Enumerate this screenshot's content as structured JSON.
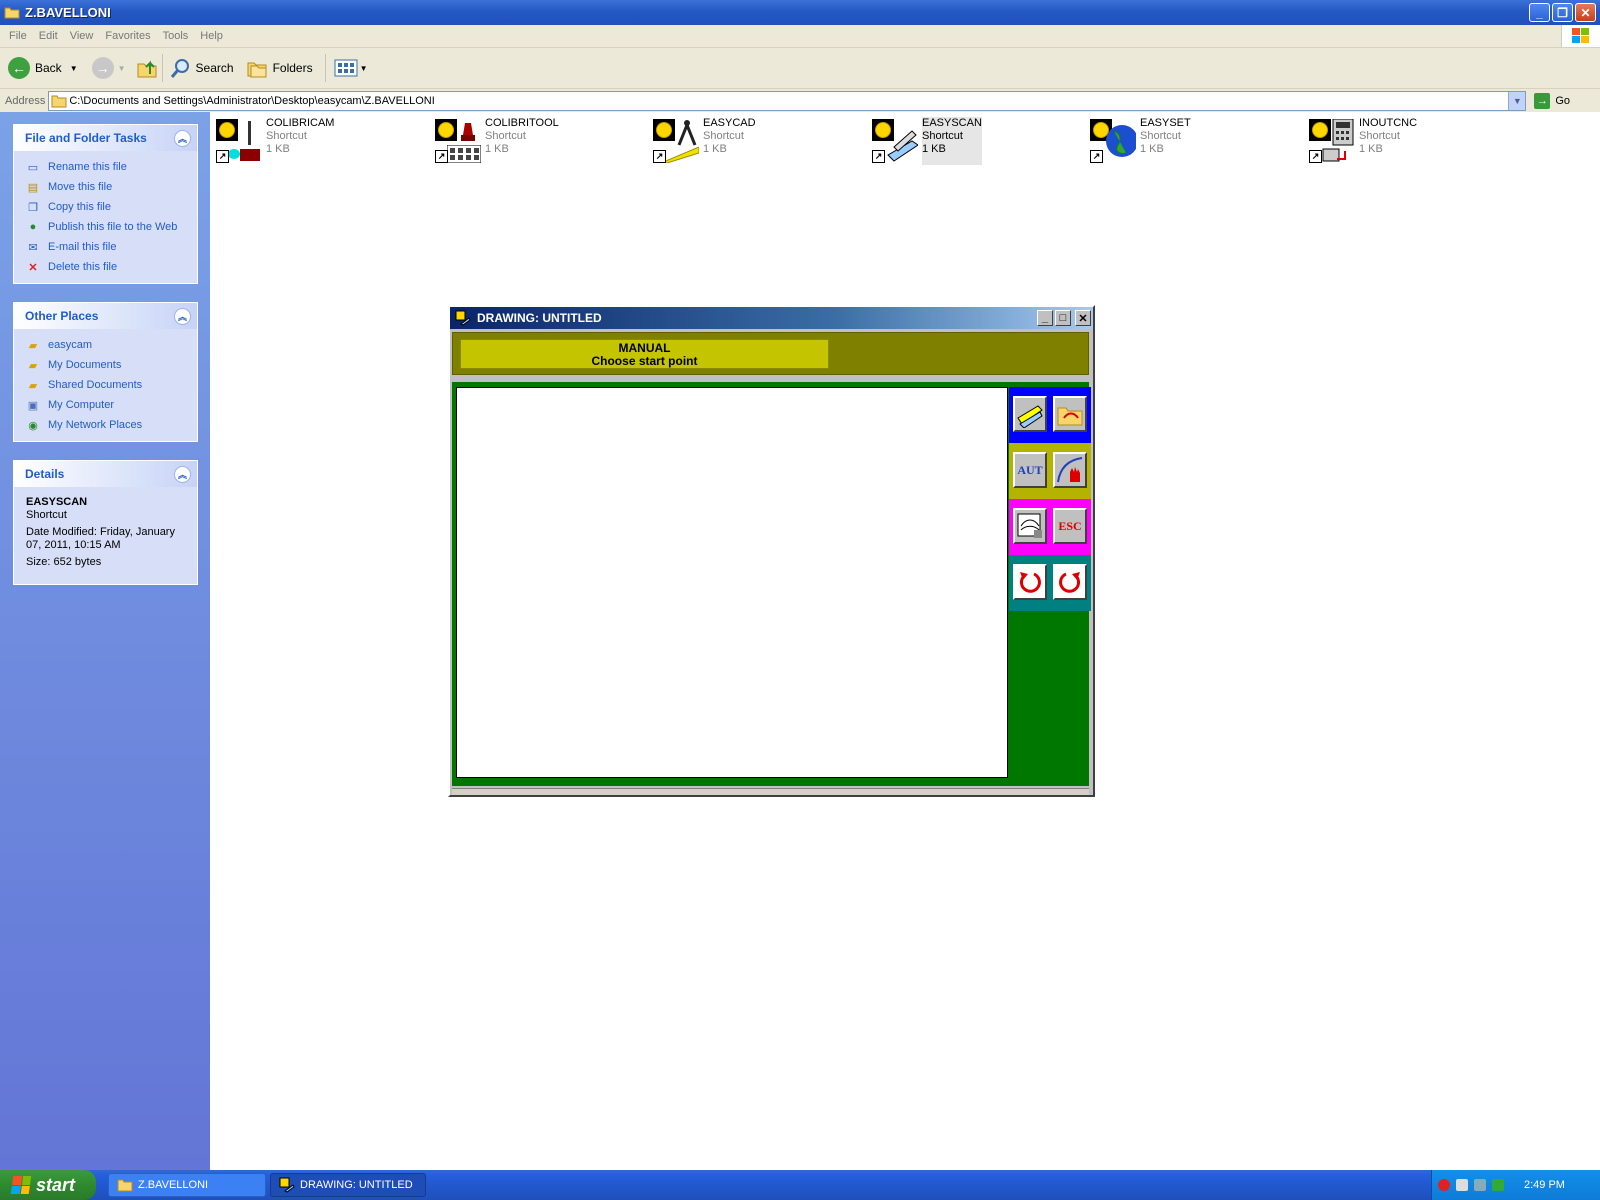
{
  "explorer": {
    "title": "Z.BAVELLONI",
    "menu": [
      "File",
      "Edit",
      "View",
      "Favorites",
      "Tools",
      "Help"
    ],
    "toolbar": {
      "back": "Back",
      "search": "Search",
      "folders": "Folders"
    },
    "address": {
      "label": "Address",
      "value": "C:\\Documents and Settings\\Administrator\\Desktop\\easycam\\Z.BAVELLONI",
      "go": "Go"
    }
  },
  "sidebar": {
    "tasks": {
      "title": "File and Folder Tasks",
      "items": [
        {
          "label": "Rename this file",
          "icon": "rename-icon"
        },
        {
          "label": "Move this file",
          "icon": "move-icon"
        },
        {
          "label": "Copy this file",
          "icon": "copy-icon"
        },
        {
          "label": "Publish this file to the Web",
          "icon": "globe-icon"
        },
        {
          "label": "E-mail this file",
          "icon": "mail-icon"
        },
        {
          "label": "Delete this file",
          "icon": "delete-icon"
        }
      ]
    },
    "places": {
      "title": "Other Places",
      "items": [
        {
          "label": "easycam",
          "icon": "folder-icon"
        },
        {
          "label": "My Documents",
          "icon": "documents-icon"
        },
        {
          "label": "Shared Documents",
          "icon": "folder-icon"
        },
        {
          "label": "My Computer",
          "icon": "computer-icon"
        },
        {
          "label": "My Network Places",
          "icon": "network-icon"
        }
      ]
    },
    "details": {
      "title": "Details",
      "name": "EASYSCAN",
      "type": "Shortcut",
      "modified": "Date Modified: Friday, January 07, 2011, 10:15 AM",
      "size": "Size: 652 bytes"
    }
  },
  "files": [
    {
      "name": "COLIBRICAM",
      "type": "Shortcut",
      "size": "1 KB"
    },
    {
      "name": "COLIBRITOOL",
      "type": "Shortcut",
      "size": "1 KB"
    },
    {
      "name": "EASYCAD",
      "type": "Shortcut",
      "size": "1 KB"
    },
    {
      "name": "EASYSCAN",
      "type": "Shortcut",
      "size": "1 KB",
      "selected": true
    },
    {
      "name": "EASYSET",
      "type": "Shortcut",
      "size": "1 KB"
    },
    {
      "name": "INOUTCNC",
      "type": "Shortcut",
      "size": "1 KB"
    }
  ],
  "drawing_window": {
    "title": "DRAWING: UNTITLED",
    "mode": "MANUAL",
    "prompt": "Choose start point",
    "tools": {
      "aut": "AUT",
      "esc": "ESC"
    },
    "colors": {
      "frame": "#007700",
      "status": "#808000",
      "status_box": "#c4c400",
      "group1": "#0000ff",
      "group2": "#b4b400",
      "group3": "#ff00ff",
      "group4": "#008080"
    }
  },
  "taskbar": {
    "start": "start",
    "buttons": [
      {
        "label": "Z.BAVELLONI"
      },
      {
        "label": "DRAWING: UNTITLED"
      }
    ],
    "clock": "2:49 PM"
  }
}
